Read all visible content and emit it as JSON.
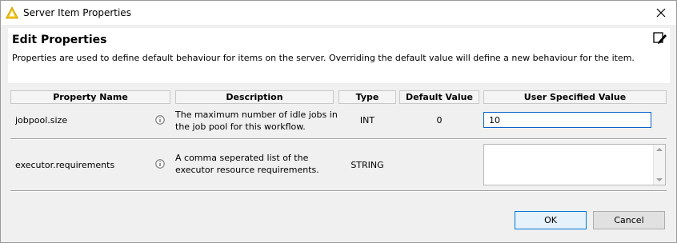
{
  "window": {
    "title": "Server Item Properties",
    "icon": "warning-triangle-icon"
  },
  "header": {
    "title": "Edit Properties",
    "description": "Properties are used to define default behaviour for items on the server. Overriding the default value will define a new behaviour for the item."
  },
  "table": {
    "columns": [
      "Property Name",
      "Description",
      "Type",
      "Default Value",
      "User Specified Value"
    ],
    "rows": [
      {
        "name": "jobpool.size",
        "description_line1": "The maximum number of idle jobs in",
        "description_line2": "the job pool for this workflow.",
        "type": "INT",
        "default_value": "0",
        "user_value": "10"
      },
      {
        "name": "executor.requirements",
        "description_line1": "A comma seperated list of the",
        "description_line2": "executor resource requirements.",
        "type": "STRING",
        "default_value": "",
        "user_value": ""
      }
    ]
  },
  "buttons": {
    "ok": "OK",
    "cancel": "Cancel"
  },
  "colors": {
    "accent": "#0078d7",
    "warning_icon": "#f2c200"
  }
}
